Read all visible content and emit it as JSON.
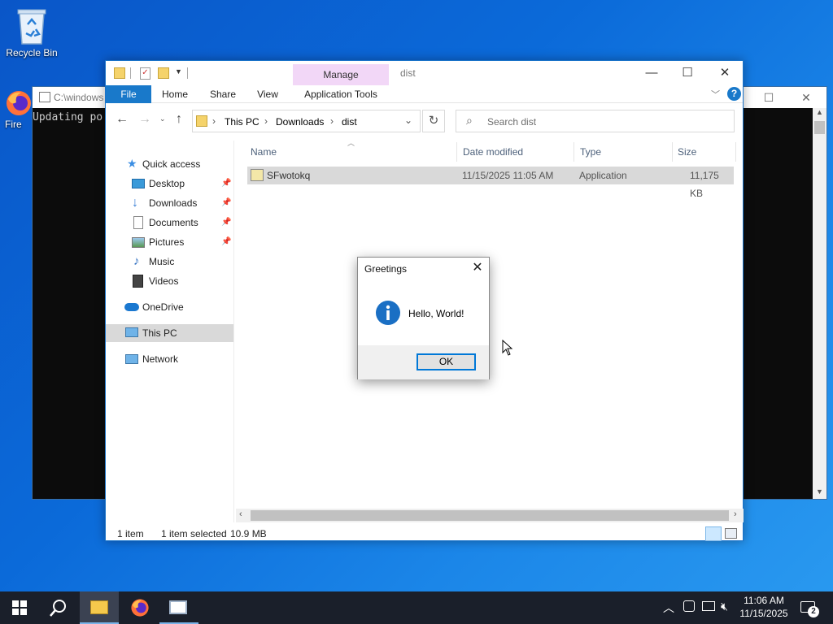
{
  "desktop": {
    "recycle_bin_label": "Recycle Bin",
    "firefox_label": "Fire"
  },
  "console": {
    "title": "C:\\windows",
    "output_line": "Updating po"
  },
  "explorer": {
    "ribbon": {
      "tabs": [
        "File",
        "Home",
        "Share",
        "View"
      ],
      "contextual_header": "Manage",
      "contextual_tab": "Application Tools",
      "window_title": "dist"
    },
    "address": {
      "crumbs": [
        "This PC",
        "Downloads",
        "dist"
      ],
      "search_placeholder": "Search dist"
    },
    "nav": {
      "quick_access": "Quick access",
      "items": [
        {
          "label": "Desktop",
          "icon": "desktop-icon",
          "pinned": true
        },
        {
          "label": "Downloads",
          "icon": "downloads-icon",
          "pinned": true
        },
        {
          "label": "Documents",
          "icon": "documents-icon",
          "pinned": true
        },
        {
          "label": "Pictures",
          "icon": "pictures-icon",
          "pinned": true
        },
        {
          "label": "Music",
          "icon": "music-icon",
          "pinned": false
        },
        {
          "label": "Videos",
          "icon": "videos-icon",
          "pinned": false
        }
      ],
      "onedrive": "OneDrive",
      "this_pc": "This PC",
      "network": "Network"
    },
    "columns": {
      "name": "Name",
      "date": "Date modified",
      "type": "Type",
      "size": "Size"
    },
    "files": [
      {
        "name": "SFwotokq",
        "date": "11/15/2025 11:05 AM",
        "type": "Application",
        "size": "11,175 KB"
      }
    ],
    "status": {
      "count": "1 item",
      "selected": "1 item selected",
      "size": "10.9 MB"
    }
  },
  "dialog": {
    "title": "Greetings",
    "message": "Hello, World!",
    "ok_label": "OK"
  },
  "taskbar": {
    "time": "11:06 AM",
    "date": "11/15/2025",
    "notification_count": "2"
  },
  "colors": {
    "accent": "#1979ca",
    "selection": "#d9d9d9",
    "manage_tab": "#f2d7f7",
    "taskbar": "#1a1f2a"
  }
}
